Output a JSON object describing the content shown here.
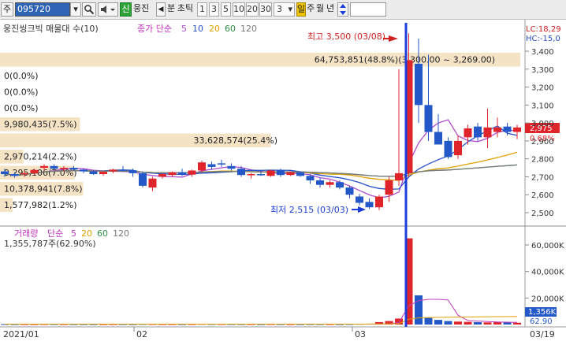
{
  "toolbar": {
    "market": "주",
    "stock_code": "095720",
    "search_icon": "magnifier-icon",
    "speaker_icon": "speaker-icon",
    "credit_badge": "신",
    "stock_name": "웅진",
    "prev_arrow": "◀",
    "period_unit": "분",
    "tick_label": "초틱",
    "periods": [
      "1",
      "3",
      "5",
      "10",
      "20",
      "30"
    ],
    "interval_value": "3",
    "day": "일",
    "week": "주",
    "month": "월",
    "year": "년",
    "updown_icon": "updown-arrow-icon",
    "extra_input": ""
  },
  "price_panel": {
    "legend_title": "웅진씽크빅 매물대 수(10)",
    "ma_label": "종가 단순",
    "ma_periods": [
      "5",
      "10",
      "20",
      "60",
      "120"
    ],
    "ma_colors": [
      "#b14bd0",
      "#2650c8",
      "#e0a000",
      "#2f8f43",
      "#7a7a7a"
    ],
    "lc_label": "LC:18,29",
    "hc_label": "HC:-15,0",
    "high_label": "최고 3,500 (03/08)",
    "low_label": "최저 2,515 (03/03)",
    "last_price": "2,975",
    "last_change": "0.68%",
    "price_axis": [
      "3,400",
      "3,300",
      "3,200",
      "3,100",
      "3,000",
      "2,900",
      "2,800",
      "2,700",
      "2,600",
      "2,500"
    ],
    "volume_profile": [
      {
        "text": "64,753,851(48.8%)(3,300.00 ~ 3,269.00)",
        "percent": 48.8
      },
      {
        "text": "0(0.0%)",
        "percent": 0.0
      },
      {
        "text": "0(0.0%)",
        "percent": 0.0
      },
      {
        "text": "0(0.0%)",
        "percent": 0.0
      },
      {
        "text": "9,980,435(7.5%)",
        "percent": 7.5
      },
      {
        "text": "33,628,574(25.4%)",
        "percent": 25.4
      },
      {
        "text": "2,970,214(2.2%)",
        "percent": 2.2
      },
      {
        "text": "9,295,106(7.0%)",
        "percent": 7.0
      },
      {
        "text": "10,378,941(7.8%)",
        "percent": 7.8
      },
      {
        "text": "1,577,982(1.2%)",
        "percent": 1.2
      }
    ]
  },
  "volume_panel": {
    "legend_title": "거래량",
    "ma_label": "단순",
    "ma_periods": [
      "5",
      "20",
      "60",
      "120"
    ],
    "ma_colors": [
      "#c03cc0",
      "#e0a000",
      "#2f8f43",
      "#7a7a7a"
    ],
    "current_volume": "1,355,787주(62.90%)",
    "axis": [
      "60,000K",
      "40,000K",
      "20,000K"
    ],
    "last_volume": "1,356K",
    "last_pct": "62.90"
  },
  "date_axis": [
    "2021/01",
    "02",
    "03",
    "03/19"
  ],
  "colors": {
    "up": "#e0242c",
    "down": "#2358c8",
    "cursor": "#1c3dd8",
    "profile": "#f5e3c6"
  },
  "candles": [
    {
      "o": 2730,
      "h": 2745,
      "l": 2700,
      "c": 2715
    },
    {
      "o": 2715,
      "h": 2725,
      "l": 2695,
      "c": 2705
    },
    {
      "o": 2720,
      "h": 2735,
      "l": 2700,
      "c": 2720
    },
    {
      "o": 2720,
      "h": 2745,
      "l": 2710,
      "c": 2738
    },
    {
      "o": 2750,
      "h": 2770,
      "l": 2735,
      "c": 2760
    },
    {
      "o": 2760,
      "h": 2770,
      "l": 2740,
      "c": 2745
    },
    {
      "o": 2745,
      "h": 2760,
      "l": 2730,
      "c": 2750
    },
    {
      "o": 2750,
      "h": 2760,
      "l": 2735,
      "c": 2740
    },
    {
      "o": 2740,
      "h": 2745,
      "l": 2720,
      "c": 2730
    },
    {
      "o": 2730,
      "h": 2735,
      "l": 2710,
      "c": 2715
    },
    {
      "o": 2715,
      "h": 2730,
      "l": 2705,
      "c": 2728
    },
    {
      "o": 2730,
      "h": 2745,
      "l": 2720,
      "c": 2740
    },
    {
      "o": 2740,
      "h": 2760,
      "l": 2730,
      "c": 2735
    },
    {
      "o": 2735,
      "h": 2745,
      "l": 2700,
      "c": 2720
    },
    {
      "o": 2720,
      "h": 2730,
      "l": 2640,
      "c": 2650
    },
    {
      "o": 2640,
      "h": 2700,
      "l": 2620,
      "c": 2690
    },
    {
      "o": 2700,
      "h": 2720,
      "l": 2690,
      "c": 2715
    },
    {
      "o": 2710,
      "h": 2730,
      "l": 2700,
      "c": 2725
    },
    {
      "o": 2725,
      "h": 2745,
      "l": 2705,
      "c": 2712
    },
    {
      "o": 2712,
      "h": 2740,
      "l": 2700,
      "c": 2735
    },
    {
      "o": 2735,
      "h": 2790,
      "l": 2725,
      "c": 2780
    },
    {
      "o": 2770,
      "h": 2785,
      "l": 2740,
      "c": 2755
    },
    {
      "o": 2775,
      "h": 2795,
      "l": 2755,
      "c": 2770
    },
    {
      "o": 2760,
      "h": 2775,
      "l": 2735,
      "c": 2745
    },
    {
      "o": 2745,
      "h": 2760,
      "l": 2700,
      "c": 2710
    },
    {
      "o": 2710,
      "h": 2720,
      "l": 2690,
      "c": 2715
    },
    {
      "o": 2715,
      "h": 2730,
      "l": 2705,
      "c": 2712
    },
    {
      "o": 2705,
      "h": 2740,
      "l": 2700,
      "c": 2735
    },
    {
      "o": 2735,
      "h": 2745,
      "l": 2700,
      "c": 2710
    },
    {
      "o": 2710,
      "h": 2730,
      "l": 2705,
      "c": 2725
    },
    {
      "o": 2725,
      "h": 2730,
      "l": 2700,
      "c": 2705
    },
    {
      "o": 2705,
      "h": 2715,
      "l": 2660,
      "c": 2680
    },
    {
      "o": 2680,
      "h": 2695,
      "l": 2640,
      "c": 2655
    },
    {
      "o": 2655,
      "h": 2680,
      "l": 2640,
      "c": 2670
    },
    {
      "o": 2670,
      "h": 2680,
      "l": 2630,
      "c": 2640
    },
    {
      "o": 2640,
      "h": 2650,
      "l": 2580,
      "c": 2600
    },
    {
      "o": 2590,
      "h": 2605,
      "l": 2540,
      "c": 2555
    },
    {
      "o": 2560,
      "h": 2580,
      "l": 2520,
      "c": 2530
    },
    {
      "o": 2530,
      "h": 2600,
      "l": 2515,
      "c": 2590
    },
    {
      "o": 2600,
      "h": 2700,
      "l": 2560,
      "c": 2680
    },
    {
      "o": 2680,
      "h": 3300,
      "l": 2650,
      "c": 2720
    },
    {
      "o": 2720,
      "h": 3500,
      "l": 2700,
      "c": 3350
    },
    {
      "o": 3330,
      "h": 3470,
      "l": 3000,
      "c": 3100
    },
    {
      "o": 3100,
      "h": 3380,
      "l": 2900,
      "c": 2950
    },
    {
      "o": 2950,
      "h": 3050,
      "l": 2880,
      "c": 2880
    },
    {
      "o": 2900,
      "h": 2920,
      "l": 2800,
      "c": 2810
    },
    {
      "o": 2820,
      "h": 2930,
      "l": 2800,
      "c": 2900
    },
    {
      "o": 2920,
      "h": 2990,
      "l": 2880,
      "c": 2970
    },
    {
      "o": 2980,
      "h": 3000,
      "l": 2900,
      "c": 2920
    },
    {
      "o": 2920,
      "h": 3080,
      "l": 2860,
      "c": 2975
    },
    {
      "o": 2950,
      "h": 3030,
      "l": 2920,
      "c": 2975
    },
    {
      "o": 2980,
      "h": 3000,
      "l": 2930,
      "c": 2950
    },
    {
      "o": 2950,
      "h": 2990,
      "l": 2910,
      "c": 2975
    }
  ],
  "volumes": [
    300,
    250,
    280,
    260,
    320,
    300,
    280,
    260,
    250,
    240,
    260,
    280,
    270,
    260,
    400,
    350,
    300,
    280,
    260,
    300,
    450,
    380,
    350,
    300,
    320,
    280,
    260,
    300,
    280,
    260,
    250,
    300,
    320,
    280,
    260,
    350,
    500,
    600,
    1800,
    2600,
    4500,
    65000,
    22000,
    5000,
    3500,
    2600,
    2200,
    2000,
    1800,
    1600,
    1800,
    1500,
    1356
  ],
  "volume_ma5": [
    300,
    300,
    300,
    300,
    300,
    300,
    300,
    300,
    300,
    300,
    300,
    300,
    300,
    300,
    300,
    300,
    300,
    300,
    300,
    300,
    300,
    300,
    300,
    300,
    300,
    300,
    300,
    300,
    300,
    300,
    300,
    300,
    300,
    300,
    300,
    300,
    300,
    300,
    400,
    600,
    1500,
    14000,
    18000,
    19000,
    19000,
    18500,
    7000,
    3000,
    2600,
    2200,
    1900,
    1800,
    1600
  ]
}
